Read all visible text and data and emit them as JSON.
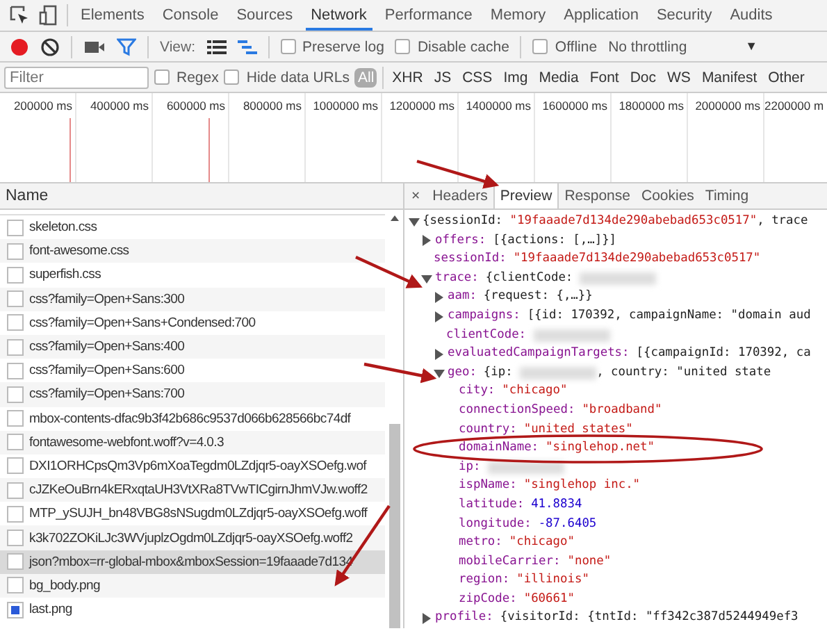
{
  "main_tabs": [
    {
      "label": "Elements",
      "selected": false
    },
    {
      "label": "Console",
      "selected": false
    },
    {
      "label": "Sources",
      "selected": false
    },
    {
      "label": "Network",
      "selected": true
    },
    {
      "label": "Performance",
      "selected": false
    },
    {
      "label": "Memory",
      "selected": false
    },
    {
      "label": "Application",
      "selected": false
    },
    {
      "label": "Security",
      "selected": false
    },
    {
      "label": "Audits",
      "selected": false
    }
  ],
  "toolbar": {
    "recording": true,
    "filter_active": true,
    "view_label": "View:",
    "views": [
      {
        "kind": "list",
        "selected": false
      },
      {
        "kind": "waterfall",
        "selected": true
      }
    ],
    "options": [
      {
        "label": "Preserve log",
        "checked": false
      },
      {
        "label": "Disable cache",
        "checked": false
      }
    ],
    "offline": {
      "label": "Offline",
      "checked": false
    },
    "throttling": "No throttling",
    "dropdown_arrow": "▼"
  },
  "filter_bar": {
    "placeholder": "Filter",
    "options": [
      {
        "label": "Regex",
        "checked": false
      },
      {
        "label": "Hide data URLs",
        "checked": false
      }
    ],
    "types": [
      {
        "label": "All",
        "selected": true
      },
      {
        "label": "XHR",
        "selected": false
      },
      {
        "label": "JS",
        "selected": false
      },
      {
        "label": "CSS",
        "selected": false
      },
      {
        "label": "Img",
        "selected": false
      },
      {
        "label": "Media",
        "selected": false
      },
      {
        "label": "Font",
        "selected": false
      },
      {
        "label": "Doc",
        "selected": false
      },
      {
        "label": "WS",
        "selected": false
      },
      {
        "label": "Manifest",
        "selected": false
      },
      {
        "label": "Other",
        "selected": false
      }
    ]
  },
  "timeline": {
    "ticks": [
      "200000 ms",
      "400000 ms",
      "600000 ms",
      "800000 ms",
      "1000000 ms",
      "1200000 ms",
      "1400000 ms",
      "1600000 ms",
      "1800000 ms",
      "2000000 ms",
      "2200000 m"
    ]
  },
  "requests": {
    "column": "Name",
    "rows": [
      {
        "name": "skeleton.css",
        "kind": "file",
        "selected": false
      },
      {
        "name": "font-awesome.css",
        "kind": "file",
        "selected": false
      },
      {
        "name": "superfish.css",
        "kind": "file",
        "selected": false
      },
      {
        "name": "css?family=Open+Sans:300",
        "kind": "file",
        "selected": false
      },
      {
        "name": "css?family=Open+Sans+Condensed:700",
        "kind": "file",
        "selected": false
      },
      {
        "name": "css?family=Open+Sans:400",
        "kind": "file",
        "selected": false
      },
      {
        "name": "css?family=Open+Sans:600",
        "kind": "file",
        "selected": false
      },
      {
        "name": "css?family=Open+Sans:700",
        "kind": "file",
        "selected": false
      },
      {
        "name": "mbox-contents-dfac9b3f42b686c9537d066b628566bc74df",
        "kind": "file",
        "selected": false
      },
      {
        "name": "fontawesome-webfont.woff?v=4.0.3",
        "kind": "file",
        "selected": false
      },
      {
        "name": "DXI1ORHCpsQm3Vp6mXoaTegdm0LZdjqr5-oayXSOefg.wof",
        "kind": "file",
        "selected": false
      },
      {
        "name": "cJZKeOuBrn4kERxqtaUH3VtXRa8TVwTICgirnJhmVJw.woff2",
        "kind": "file",
        "selected": false
      },
      {
        "name": "MTP_ySUJH_bn48VBG8sNSugdm0LZdjqr5-oayXSOefg.woff",
        "kind": "file",
        "selected": false
      },
      {
        "name": "k3k702ZOKiLJc3WVjuplzOgdm0LZdjqr5-oayXSOefg.woff2",
        "kind": "file",
        "selected": false
      },
      {
        "name": "json?mbox=rr-global-mbox&mboxSession=19faaade7d134",
        "kind": "file",
        "selected": true
      },
      {
        "name": "bg_body.png",
        "kind": "file",
        "selected": false
      },
      {
        "name": "last.png",
        "kind": "thumbnail",
        "selected": false
      }
    ]
  },
  "detail": {
    "close": "×",
    "tabs": [
      {
        "label": "Headers",
        "selected": false
      },
      {
        "label": "Preview",
        "selected": true
      },
      {
        "label": "Response",
        "selected": false
      },
      {
        "label": "Cookies",
        "selected": false
      },
      {
        "label": "Timing",
        "selected": false
      }
    ],
    "preview": [
      {
        "expanded": true,
        "parts": [
          {
            "kind": "plain",
            "text": "{sessionId: "
          },
          {
            "kind": "string",
            "text": "\"19faaade7d134de290abebad653c0517\""
          },
          {
            "kind": "plain",
            "text": ", trace"
          }
        ],
        "children": [
          {
            "key": "offers:",
            "expanded": false,
            "parts": [
              {
                "kind": "plain",
                "text": "[{actions: [,…]}]"
              }
            ]
          },
          {
            "key": "sessionId:",
            "parts": [
              {
                "kind": "string",
                "text": "\"19faaade7d134de290abebad653c0517\""
              }
            ]
          },
          {
            "key": "trace:",
            "expanded": true,
            "parts": [
              {
                "kind": "plain",
                "text": "{clientCode: "
              },
              {
                "kind": "redacted"
              }
            ],
            "children": [
              {
                "key": "aam:",
                "expanded": false,
                "parts": [
                  {
                    "kind": "plain",
                    "text": "{request: {,…}}"
                  }
                ]
              },
              {
                "key": "campaigns:",
                "expanded": false,
                "parts": [
                  {
                    "kind": "plain",
                    "text": "[{id: 170392, campaignName: \"domain aud"
                  }
                ]
              },
              {
                "key": "clientCode:",
                "parts": [
                  {
                    "kind": "redacted"
                  }
                ]
              },
              {
                "key": "evaluatedCampaignTargets:",
                "expanded": false,
                "parts": [
                  {
                    "kind": "plain",
                    "text": "[{campaignId: 170392, ca"
                  }
                ]
              },
              {
                "key": "geo:",
                "expanded": true,
                "parts": [
                  {
                    "kind": "plain",
                    "text": "{ip: "
                  },
                  {
                    "kind": "redacted"
                  },
                  {
                    "kind": "plain",
                    "text": ", country: \"united state"
                  }
                ],
                "children": [
                  {
                    "key": "city:",
                    "parts": [
                      {
                        "kind": "string",
                        "text": "\"chicago\""
                      }
                    ]
                  },
                  {
                    "key": "connectionSpeed:",
                    "parts": [
                      {
                        "kind": "string",
                        "text": "\"broadband\""
                      }
                    ]
                  },
                  {
                    "key": "country:",
                    "parts": [
                      {
                        "kind": "string",
                        "text": "\"united states\""
                      }
                    ]
                  },
                  {
                    "key": "domainName:",
                    "parts": [
                      {
                        "kind": "string",
                        "text": "\"singlehop.net\""
                      }
                    ]
                  },
                  {
                    "key": "ip:",
                    "parts": [
                      {
                        "kind": "redacted"
                      }
                    ]
                  },
                  {
                    "key": "ispName:",
                    "parts": [
                      {
                        "kind": "string",
                        "text": "\"singlehop inc.\""
                      }
                    ]
                  },
                  {
                    "key": "latitude:",
                    "parts": [
                      {
                        "kind": "number",
                        "text": "41.8834"
                      }
                    ]
                  },
                  {
                    "key": "longitude:",
                    "parts": [
                      {
                        "kind": "number",
                        "text": "-87.6405"
                      }
                    ]
                  },
                  {
                    "key": "metro:",
                    "parts": [
                      {
                        "kind": "string",
                        "text": "\"chicago\""
                      }
                    ]
                  },
                  {
                    "key": "mobileCarrier:",
                    "parts": [
                      {
                        "kind": "string",
                        "text": "\"none\""
                      }
                    ]
                  },
                  {
                    "key": "region:",
                    "parts": [
                      {
                        "kind": "string",
                        "text": "\"illinois\""
                      }
                    ]
                  },
                  {
                    "key": "zipCode:",
                    "parts": [
                      {
                        "kind": "string",
                        "text": "\"60661\""
                      }
                    ]
                  }
                ]
              }
            ]
          },
          {
            "key": "profile:",
            "expanded": false,
            "parts": [
              {
                "kind": "plain",
                "text": "{visitorId: {tntId: \"ff342c387d5244949ef3"
              }
            ]
          }
        ]
      }
    ]
  }
}
